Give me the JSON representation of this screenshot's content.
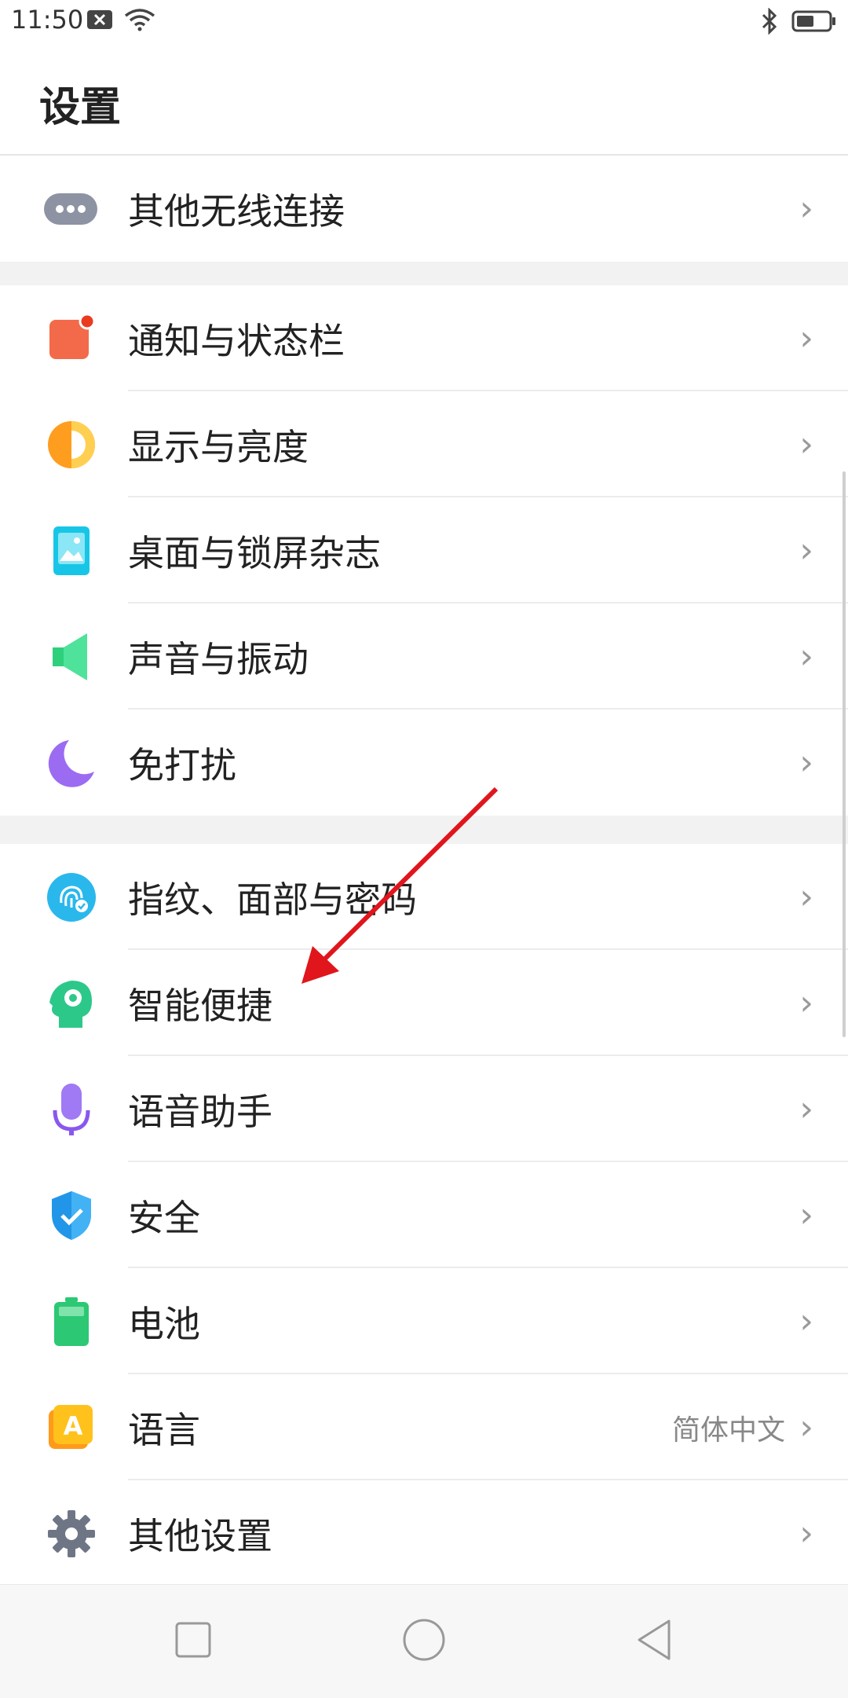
{
  "status_bar": {
    "time": "11:50",
    "left_icons": [
      "notification-x-icon",
      "wifi-icon"
    ],
    "right_icons": [
      "bluetooth-icon",
      "battery-icon"
    ],
    "battery_level": 0.5
  },
  "page": {
    "title": "设置"
  },
  "sections": [
    {
      "items": [
        {
          "label": "其他无线连接",
          "icon": "more-dots-icon"
        }
      ]
    },
    {
      "items": [
        {
          "label": "通知与状态栏",
          "icon": "notification-icon"
        },
        {
          "label": "显示与亮度",
          "icon": "brightness-icon"
        },
        {
          "label": "桌面与锁屏杂志",
          "icon": "wallpaper-icon"
        },
        {
          "label": "声音与振动",
          "icon": "speaker-icon"
        },
        {
          "label": "免打扰",
          "icon": "moon-icon"
        }
      ]
    },
    {
      "items": [
        {
          "label": "指纹、面部与密码",
          "icon": "fingerprint-icon"
        },
        {
          "label": "智能便捷",
          "icon": "smart-head-icon"
        },
        {
          "label": "语音助手",
          "icon": "microphone-icon"
        },
        {
          "label": "安全",
          "icon": "shield-icon"
        },
        {
          "label": "电池",
          "icon": "battery-item-icon"
        },
        {
          "label": "语言",
          "icon": "language-icon",
          "value": "简体中文"
        },
        {
          "label": "其他设置",
          "icon": "gear-icon"
        }
      ]
    }
  ],
  "chevron": "›",
  "nav_bar": {
    "buttons": [
      "recent-apps-button",
      "home-button",
      "back-button"
    ]
  },
  "colors": {
    "annotation": "#e0161c",
    "section_gap": "#f2f2f2"
  }
}
